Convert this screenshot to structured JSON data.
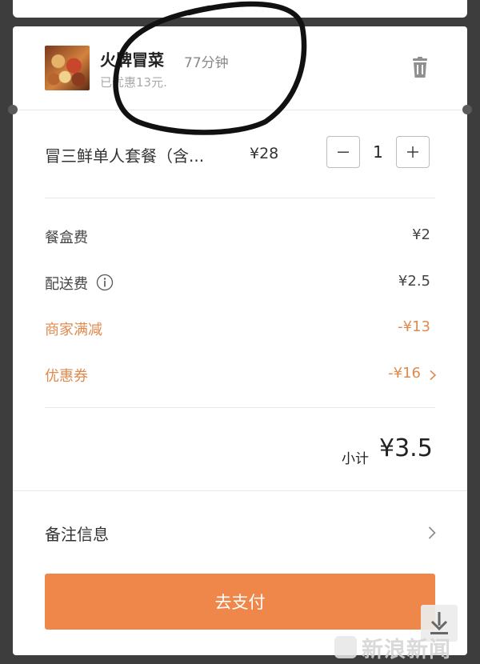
{
  "shop": {
    "name": "火牌冒菜",
    "delivery_time": "77分钟",
    "discount_note": "已优惠13元."
  },
  "item": {
    "name": "冒三鲜单人套餐（含...",
    "price": "¥28",
    "quantity": "1"
  },
  "fees": {
    "box_fee_label": "餐盒费",
    "box_fee_value": "¥2",
    "delivery_fee_label": "配送费",
    "delivery_fee_value": "¥2.5",
    "merchant_discount_label": "商家满减",
    "merchant_discount_value": "-¥13",
    "coupon_label": "优惠券",
    "coupon_value": "-¥16"
  },
  "subtotal": {
    "label": "小计",
    "value": "¥3.5"
  },
  "remarks": {
    "label": "备注信息"
  },
  "pay_button": {
    "label": "去支付"
  },
  "watermark": {
    "text": "新浪新闻"
  },
  "colors": {
    "accent_orange": "#ef874a",
    "discount_orange": "#e08a4e",
    "overlay_background": "#3d3d3d"
  },
  "icons": [
    "trash-icon",
    "minus-icon",
    "plus-icon",
    "info-icon",
    "chevron-right-icon",
    "download-icon"
  ]
}
